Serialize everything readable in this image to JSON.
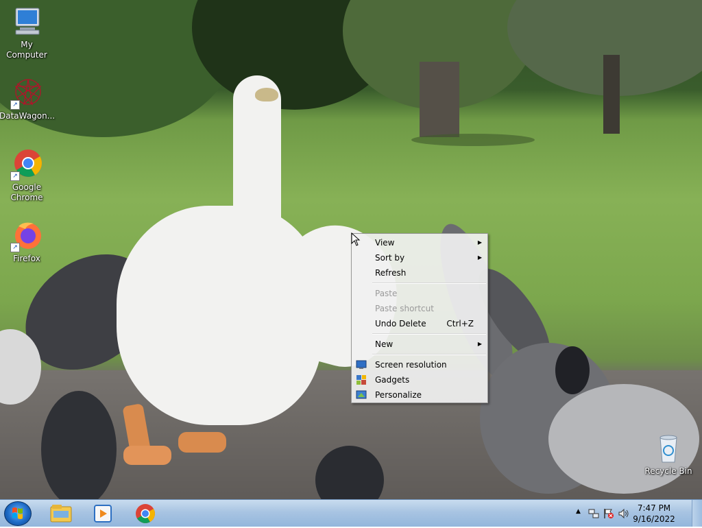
{
  "desktop": {
    "icons": [
      {
        "label": "My Computer",
        "icon": "computer-icon"
      },
      {
        "label": "DataWagon...",
        "icon": "datawagon-icon"
      },
      {
        "label": "Google Chrome",
        "icon": "chrome-icon"
      },
      {
        "label": "Firefox",
        "icon": "firefox-icon"
      },
      {
        "label": "Recycle Bin",
        "icon": "recycle-bin-icon"
      }
    ]
  },
  "context_menu": {
    "items": [
      {
        "label": "View",
        "submenu": true
      },
      {
        "label": "Sort by",
        "submenu": true
      },
      {
        "label": "Refresh"
      },
      {
        "label": "Paste",
        "disabled": true
      },
      {
        "label": "Paste shortcut",
        "disabled": true
      },
      {
        "label": "Undo Delete",
        "shortcut": "Ctrl+Z"
      },
      {
        "label": "New",
        "submenu": true
      },
      {
        "label": "Screen resolution",
        "icon": "screen-resolution-icon"
      },
      {
        "label": "Gadgets",
        "icon": "gadgets-icon"
      },
      {
        "label": "Personalize",
        "icon": "personalize-icon"
      }
    ]
  },
  "taskbar": {
    "pinned": [
      "windows-explorer-icon",
      "media-player-icon",
      "chrome-icon"
    ],
    "tray_icons": [
      "show-hidden-icons-arrow",
      "network-icon",
      "action-center-flag-icon",
      "volume-icon"
    ],
    "clock": {
      "time": "7:47 PM",
      "date": "9/16/2022"
    }
  },
  "colors": {
    "taskbar": "#a8c4e2",
    "menu_bg": "#f1f1f1",
    "menu_disabled_text": "#9a9a9a"
  }
}
